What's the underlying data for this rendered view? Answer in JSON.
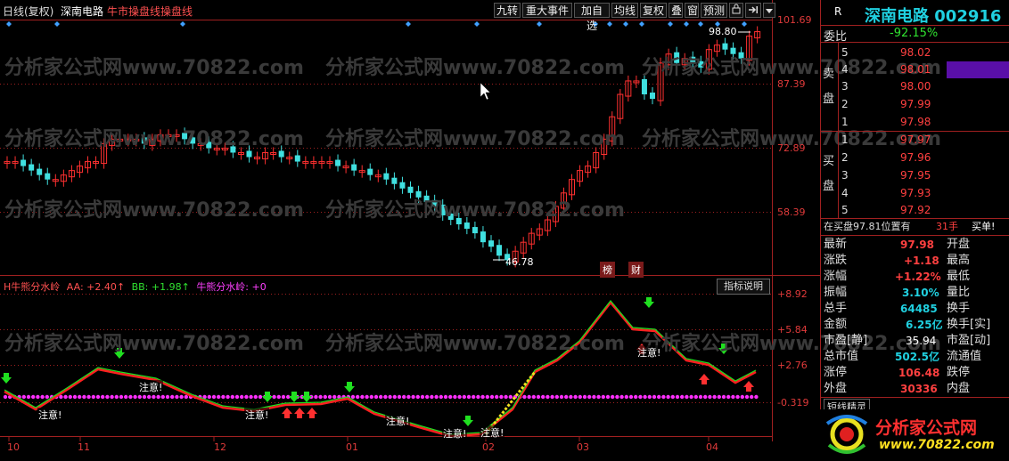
{
  "header": {
    "period": "日线(复权)",
    "stock_name": "深南电路",
    "formula_name": "牛市操盘线操盘线",
    "buttons": [
      "九转",
      "重大事件",
      "加自选",
      "均线",
      "复权",
      "叠",
      "窗",
      "预测"
    ]
  },
  "price_axis": [
    "101.69",
    "87.39",
    "72.89",
    "58.39"
  ],
  "price_extremes": {
    "high": "98.80",
    "low": "46.78"
  },
  "markers": {
    "bang": "榜",
    "cai": "财"
  },
  "indicator": {
    "legend_name": "H牛熊分水岭",
    "aa": "AA: +2.40↑",
    "bb": "BB: +1.98↑",
    "base": "牛熊分水岭: +0",
    "button": "指标说明",
    "axis": [
      "+8.92",
      "+5.84",
      "+2.76",
      "-0.319"
    ],
    "note_label": "注意!",
    "colors": {
      "aa": "#ff2020",
      "bb": "#20e020",
      "base": "#ff20ff"
    }
  },
  "date_axis": [
    "10",
    "11",
    "12",
    "01",
    "02",
    "03",
    "04"
  ],
  "watermark": "分析家公式网www.70822.com",
  "right_panel": {
    "r_label": "R",
    "title": "深南电路 002916",
    "weibi_label": "委比",
    "weibi_value": "-92.15%",
    "sell_label": "卖盘",
    "buy_label": "买盘",
    "sell": [
      {
        "lvl": "5",
        "price": "98.02"
      },
      {
        "lvl": "4",
        "price": "98.01"
      },
      {
        "lvl": "3",
        "price": "98.00"
      },
      {
        "lvl": "2",
        "price": "97.99"
      },
      {
        "lvl": "1",
        "price": "97.98"
      }
    ],
    "buy": [
      {
        "lvl": "1",
        "price": "97.97"
      },
      {
        "lvl": "2",
        "price": "97.96"
      },
      {
        "lvl": "3",
        "price": "97.95"
      },
      {
        "lvl": "4",
        "price": "97.93"
      },
      {
        "lvl": "5",
        "price": "97.92"
      }
    ],
    "status_line": "在买盘97.81位置有",
    "status_qty": "31手",
    "status_tag": "买单!",
    "stats": [
      {
        "label": "最新",
        "value": "97.98",
        "label2": "开盘"
      },
      {
        "label": "涨跌",
        "value": "+1.18",
        "label2": "最高"
      },
      {
        "label": "涨幅",
        "value": "+1.22%",
        "label2": "最低"
      },
      {
        "label": "振幅",
        "value": "3.10%",
        "label2": "量比"
      },
      {
        "label": "总手",
        "value": "64485",
        "label2": "换手"
      },
      {
        "label": "金额",
        "value": "6.25亿",
        "label2": "换手[实]"
      },
      {
        "label": "市盈[静]",
        "value": "35.94",
        "label2": "市盈[动]"
      },
      {
        "label": "总市值",
        "value": "502.5亿",
        "label2": "流通值"
      },
      {
        "label": "涨停",
        "value": "106.48",
        "label2": "跌停"
      },
      {
        "label": "外盘",
        "value": "30336",
        "label2": "内盘"
      }
    ],
    "footer": "短线精灵",
    "logo_text": "分析家公式网",
    "logo_url": "www.70822.com"
  }
}
